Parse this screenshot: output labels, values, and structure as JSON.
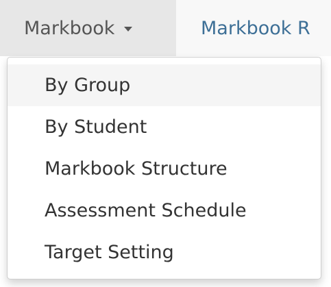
{
  "navbar": {
    "items": [
      {
        "label": "Markbook",
        "active": true,
        "has_caret": true
      },
      {
        "label": "Markbook R",
        "active": false
      }
    ]
  },
  "dropdown": {
    "items": [
      {
        "label": "By Group",
        "highlighted": true
      },
      {
        "label": "By Student"
      },
      {
        "label": "Markbook Structure"
      },
      {
        "label": "Assessment Schedule"
      },
      {
        "label": "Target Setting"
      }
    ]
  },
  "colors": {
    "navbar_bg": "#f8f8f8",
    "active_bg": "#e7e7e7",
    "link": "#3d6f96",
    "text": "#333333",
    "highlight_bg": "#f5f5f5"
  }
}
